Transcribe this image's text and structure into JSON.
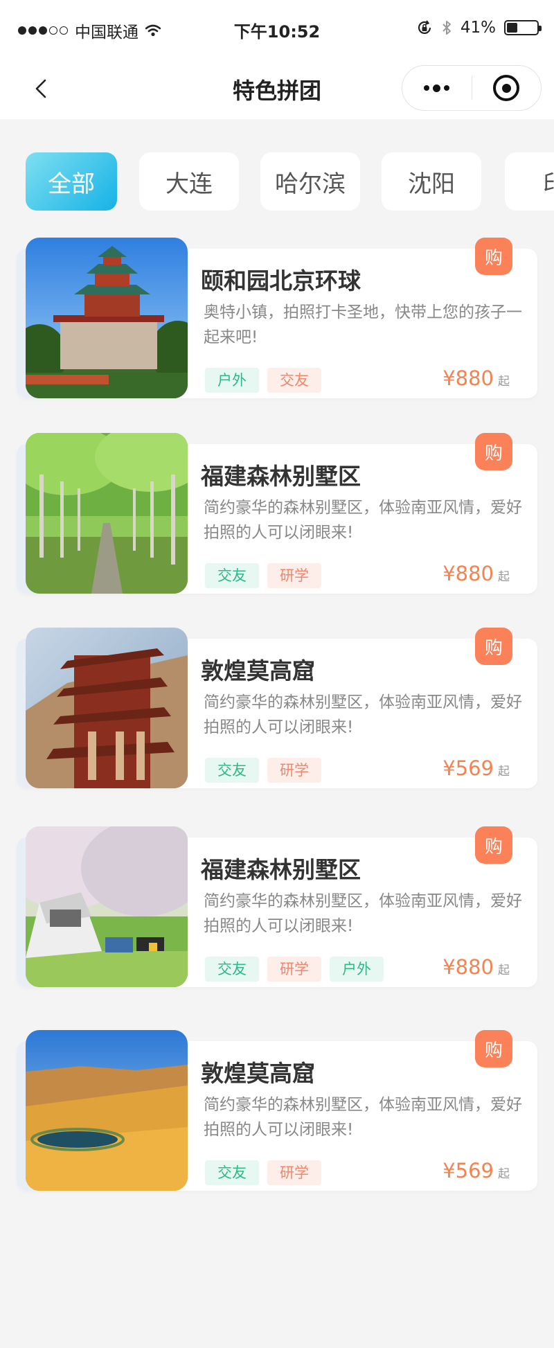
{
  "status_bar": {
    "carrier": "中国联通",
    "time": "下午10:52",
    "battery_text": "41%",
    "battery_level": 0.41
  },
  "nav": {
    "title": "特色拼团"
  },
  "tabs": [
    {
      "label": "全部",
      "active": true
    },
    {
      "label": "大连",
      "active": false
    },
    {
      "label": "哈尔滨",
      "active": false
    },
    {
      "label": "沈阳",
      "active": false
    },
    {
      "label": "印",
      "active": false
    }
  ],
  "colors": {
    "accent_blue": "#16b2e6",
    "buy_orange": "#fa8158",
    "price_orange": "#f6834f",
    "tag_green_text": "#2eb986",
    "tag_orange_text": "#f3866a"
  },
  "cards": [
    {
      "title": "颐和园北京环球",
      "desc": "奥特小镇，拍照打卡圣地，快带上您的孩子一起来吧!",
      "tags": [
        {
          "label": "户外",
          "color": "green"
        },
        {
          "label": "交友",
          "color": "orange"
        }
      ],
      "price": "¥880",
      "price_suffix": "起",
      "buy_label": "购",
      "image": "summer-palace-pagoda"
    },
    {
      "title": "福建森林别墅区",
      "desc": "简约豪华的森林别墅区，体验南亚风情，爱好拍照的人可以闭眼来!",
      "tags": [
        {
          "label": "交友",
          "color": "green"
        },
        {
          "label": "研学",
          "color": "orange"
        }
      ],
      "price": "¥880",
      "price_suffix": "起",
      "buy_label": "购",
      "image": "forest-path"
    },
    {
      "title": "敦煌莫高窟",
      "desc": "简约豪华的森林别墅区，体验南亚风情，爱好拍照的人可以闭眼来!",
      "tags": [
        {
          "label": "交友",
          "color": "green"
        },
        {
          "label": "研学",
          "color": "orange"
        }
      ],
      "price": "¥569",
      "price_suffix": "起",
      "buy_label": "购",
      "image": "mogao-pagoda"
    },
    {
      "title": "福建森林别墅区",
      "desc": "简约豪华的森林别墅区，体验南亚风情，爱好拍照的人可以闭眼来!",
      "tags": [
        {
          "label": "交友",
          "color": "green"
        },
        {
          "label": "研学",
          "color": "orange"
        },
        {
          "label": "户外",
          "color": "green"
        }
      ],
      "price": "¥880",
      "price_suffix": "起",
      "buy_label": "购",
      "image": "camping-tent"
    },
    {
      "title": "敦煌莫高窟",
      "desc": "简约豪华的森林别墅区，体验南亚风情，爱好拍照的人可以闭眼来!",
      "tags": [
        {
          "label": "交友",
          "color": "green"
        },
        {
          "label": "研学",
          "color": "orange"
        }
      ],
      "price": "¥569",
      "price_suffix": "起",
      "buy_label": "购",
      "image": "desert-oasis"
    }
  ]
}
